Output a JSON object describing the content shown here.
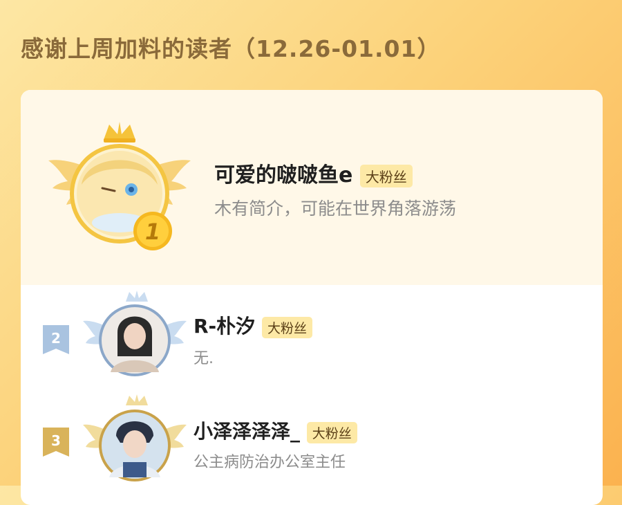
{
  "header": {
    "title": "感谢上周加料的读者（12.26-01.01）"
  },
  "readers": [
    {
      "rank": "1",
      "name": "可爱的啵啵鱼e",
      "badge": "大粉丝",
      "bio": "木有简介，可能在世界角落游荡"
    },
    {
      "rank": "2",
      "name": "R-朴汐",
      "badge": "大粉丝",
      "bio": "无."
    },
    {
      "rank": "3",
      "name": "小泽泽泽泽_",
      "badge": "大粉丝",
      "bio": "公主病防治办公室主任"
    }
  ],
  "colors": {
    "background_start": "#fde7a4",
    "background_end": "#fbb24f",
    "title": "#8a6a3a",
    "badge_bg": "#fde9a6",
    "gold": "#f5b820",
    "silver": "#9fb8d6",
    "bronze": "#d4a84a"
  },
  "icons": [
    "crown-icon",
    "wing-icon",
    "rank-medal-icon",
    "rank-ribbon-icon"
  ]
}
